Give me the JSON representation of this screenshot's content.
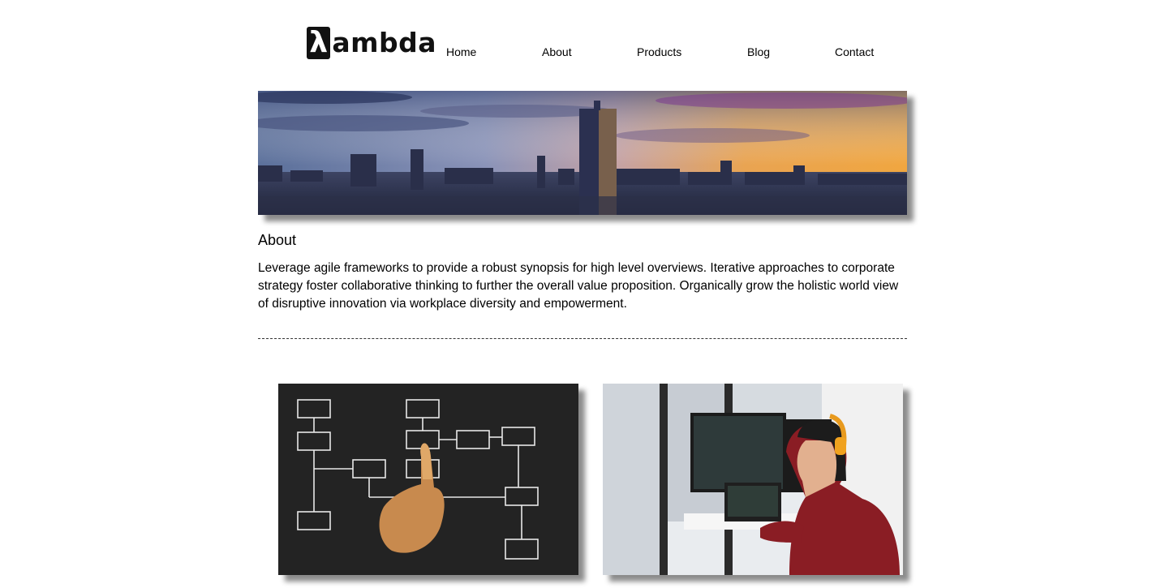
{
  "brand": {
    "mark": "λ",
    "word": "ambda"
  },
  "nav": {
    "items": [
      {
        "label": "Home"
      },
      {
        "label": "About"
      },
      {
        "label": "Products"
      },
      {
        "label": "Blog"
      },
      {
        "label": "Contact"
      }
    ]
  },
  "about": {
    "heading": "About",
    "body": "Leverage agile frameworks to provide a robust synopsis for high level overviews. Iterative approaches to corporate strategy foster collaborative thinking to further the overall value proposition. Organically grow the holistic world view of disruptive innovation via workplace diversity and empowerment."
  },
  "colors": {
    "text": "#000000",
    "shadow": "#8c8c8c",
    "chalkboard": "#232323"
  }
}
